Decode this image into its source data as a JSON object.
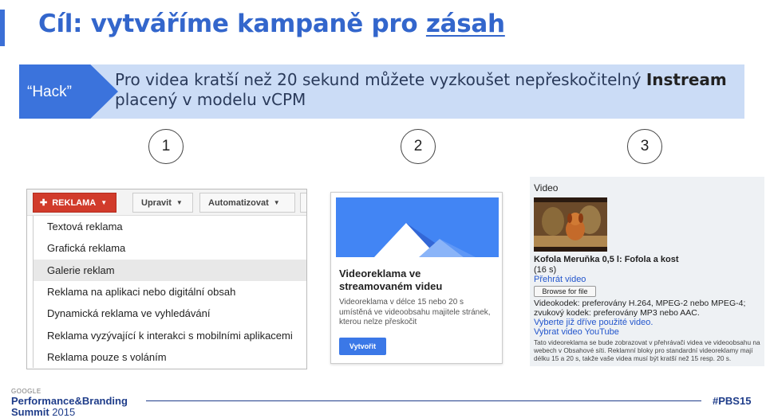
{
  "slide": {
    "title_prefix": "Cíl: vytváříme kampaně pro",
    "title_underlined": "zásah",
    "banner_tag": "“Hack”",
    "banner_text": "Pro videa kratší než 20 sekund můžete vyzkoušet nepřeskočitelný",
    "banner_bold": "Instream",
    "banner_text_end": "placený v modelu vCPM",
    "steps": [
      "1",
      "2",
      "3"
    ]
  },
  "panel1": {
    "primary_button": "REKLAMA",
    "edit_button": "Upravit",
    "automate_button": "Automatizovat",
    "menu_items": [
      {
        "label": "Textová reklama",
        "active": false
      },
      {
        "label": "Grafická reklama",
        "active": false
      },
      {
        "label": "Galerie reklam",
        "active": true
      },
      {
        "label": "Reklama na aplikaci nebo digitální obsah",
        "active": false
      },
      {
        "label": "Dynamická reklama ve vyhledávání",
        "active": false
      },
      {
        "label": "Reklama vyzývající k interakci s mobilními aplikacemi",
        "active": false
      },
      {
        "label": "Reklama pouze s voláním",
        "active": false
      }
    ]
  },
  "panel2": {
    "heading": "Videoreklama ve streamovaném videu",
    "description": "Videoreklama v délce 15 nebo 20 s umístěná ve videoobsahu majitele stránek, kterou nelze přeskočit",
    "create_button": "Vytvořit"
  },
  "panel3": {
    "label": "Video",
    "video_title": "Kofola Meruňka 0,5 l: Fofola a kost",
    "duration": "(16 s)",
    "play_link": "Přehrát video",
    "browse_button": "Browse for file",
    "videocodec_line1": "Videokodek: preferovány H.264, MPEG-2 nebo MPEG-4;",
    "videocodec_line2": "zvukový kodek: preferovány MP3 nebo AAC.",
    "pick_link": "Vyberte již dříve použité video.",
    "youtube_link": "Vybrat video YouTube",
    "note": "Tato videoreklama se bude zobrazovat v přehrávači videa ve videoobsahu na webech v Obsahové síti. Reklamní bloky pro standardní videoreklamy mají délku 15 a 20 s, takže vaše videa musí být kratší než 15 resp. 20 s."
  },
  "footer": {
    "google": "GOOGLE",
    "brand": "Performance&Branding",
    "summit": "Summit",
    "year": "2015",
    "hashtag": "#PBS15"
  },
  "colors": {
    "title": "#3366cc",
    "banner_bg": "#cbdcf6",
    "banner_tag": "#3b73dc",
    "primary_red": "#d13b2b",
    "footer_navy": "#1f3d8a"
  }
}
